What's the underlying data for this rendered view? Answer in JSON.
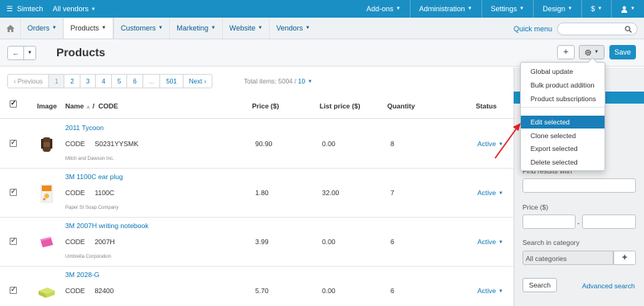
{
  "topbar": {
    "brand": "Simtech",
    "vendors": "All vendors",
    "items": [
      "Add-ons",
      "Administration",
      "Settings",
      "Design",
      "$"
    ]
  },
  "navbar": {
    "items": [
      "Orders",
      "Products",
      "Customers",
      "Marketing",
      "Website",
      "Vendors"
    ],
    "active_index": 1,
    "quick_menu": "Quick menu"
  },
  "page": {
    "title": "Products",
    "save_label": "Save"
  },
  "pagination": {
    "prev": "Previous",
    "pages": [
      "1",
      "2",
      "3",
      "4",
      "5",
      "6",
      "...",
      "501"
    ],
    "next": "Next",
    "total_label": "Total items: 5004 /",
    "per_page": "10"
  },
  "table": {
    "columns": {
      "image": "Image",
      "name": "Name",
      "code": "CODE",
      "price": "Price ($)",
      "list_price": "List price ($)",
      "quantity": "Quantity",
      "status": "Status"
    },
    "code_label": "CODE",
    "rows": [
      {
        "name": "2011 Tycoon",
        "code": "S0231YYSMK",
        "vendor": "Mitch and Dawson Inc.",
        "price": "90.90",
        "list_price": "0.00",
        "quantity": "8",
        "status": "Active"
      },
      {
        "name": "3M 1100C ear plug",
        "code": "1100C",
        "vendor": "Paper St Soap Company",
        "price": "1.80",
        "list_price": "32.00",
        "quantity": "7",
        "status": "Active"
      },
      {
        "name": "3M 2007H writing notebook",
        "code": "2007H",
        "vendor": "Umbrella Corporation",
        "price": "3.99",
        "list_price": "0.00",
        "quantity": "6",
        "status": "Active"
      },
      {
        "name": "3M 2028-G",
        "code": "82400",
        "vendor": "",
        "price": "5.70",
        "list_price": "0.00",
        "quantity": "6",
        "status": "Active"
      }
    ]
  },
  "dropdown": {
    "items": [
      "Global update",
      "Bulk product addition",
      "Product subscriptions",
      "Edit selected",
      "Clone selected",
      "Export selected",
      "Delete selected"
    ],
    "active_index": 3
  },
  "sidebar": {
    "partial_label": "Find results with",
    "price_label": "Price ($)",
    "category_label": "Search in category",
    "category_value": "All categories",
    "search_button": "Search",
    "advanced_search": "Advanced search"
  },
  "colors": {
    "accent": "#1a8fc4",
    "link": "#0a76b5",
    "arrow": "#e02020"
  }
}
